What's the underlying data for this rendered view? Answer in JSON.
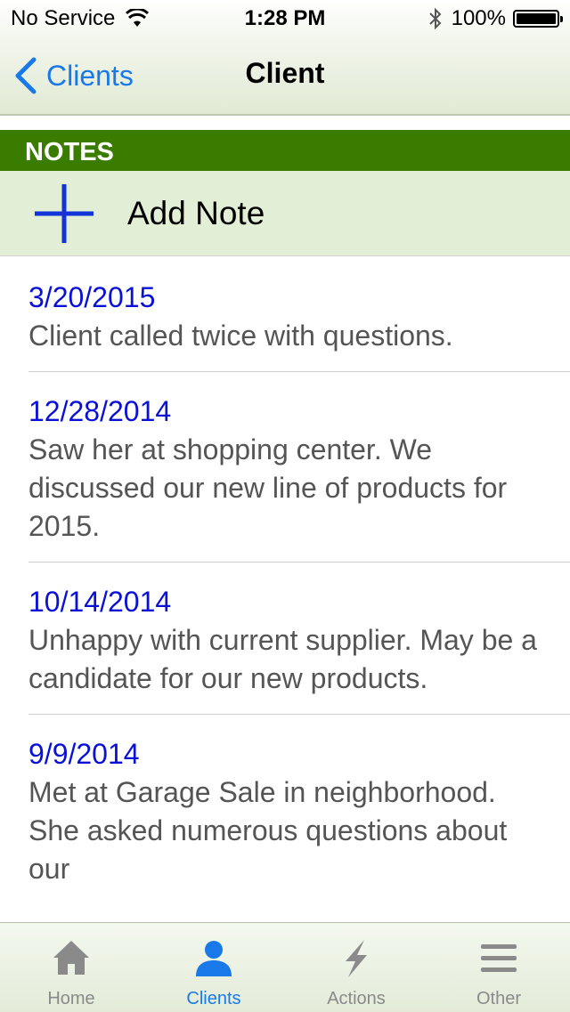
{
  "status_bar": {
    "carrier": "No Service",
    "time": "1:28 PM",
    "battery": "100%"
  },
  "nav": {
    "back_label": "Clients",
    "title": "Client"
  },
  "section": {
    "title": "NOTES"
  },
  "add_note": {
    "label": "Add Note"
  },
  "notes": [
    {
      "date": "3/20/2015",
      "text": "Client called twice with questions."
    },
    {
      "date": "12/28/2014",
      "text": "Saw her at shopping center. We discussed our new line of products for 2015."
    },
    {
      "date": "10/14/2014",
      "text": "Unhappy with current supplier. May be a candidate for our new products."
    },
    {
      "date": "9/9/2014",
      "text": "Met at Garage Sale in neighborhood. She asked numerous questions about our"
    }
  ],
  "tabs": [
    {
      "label": "Home",
      "icon": "home-icon"
    },
    {
      "label": "Clients",
      "icon": "person-icon"
    },
    {
      "label": "Actions",
      "icon": "lightning-icon"
    },
    {
      "label": "Other",
      "icon": "menu-icon"
    }
  ],
  "colors": {
    "accent": "#1a79e8",
    "section_header": "#3a7c00",
    "add_row": "#e2eed5",
    "note_date": "#0a11d6"
  }
}
